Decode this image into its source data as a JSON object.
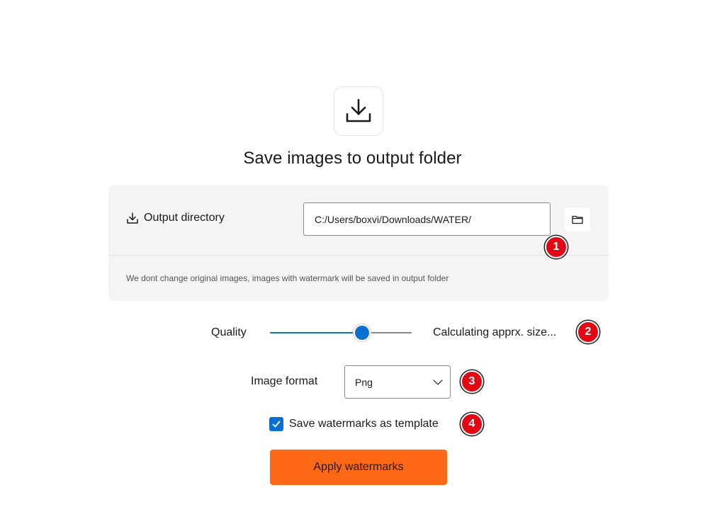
{
  "hero": {
    "icon": "download-icon",
    "title": "Save images to output folder"
  },
  "output": {
    "label": "Output directory",
    "label_icon": "download-icon",
    "path_value": "C:/Users/boxvi/Downloads/WATER/",
    "browse_icon": "folder-icon",
    "note": "We dont change original images, images with watermark will be saved in output folder"
  },
  "quality": {
    "label": "Quality",
    "value_fraction": 0.65,
    "size_text": "Calculating apprx. size..."
  },
  "format": {
    "label": "Image format",
    "selected": "Png"
  },
  "template": {
    "label": "Save watermarks as template",
    "checked": true
  },
  "actions": {
    "apply_label": "Apply watermarks"
  },
  "badges": [
    "1",
    "2",
    "3",
    "4"
  ],
  "colors": {
    "accent": "#0a6fd0",
    "primary_button": "#ff6915",
    "badge": "#e30613",
    "card": "#f4f4f4"
  }
}
